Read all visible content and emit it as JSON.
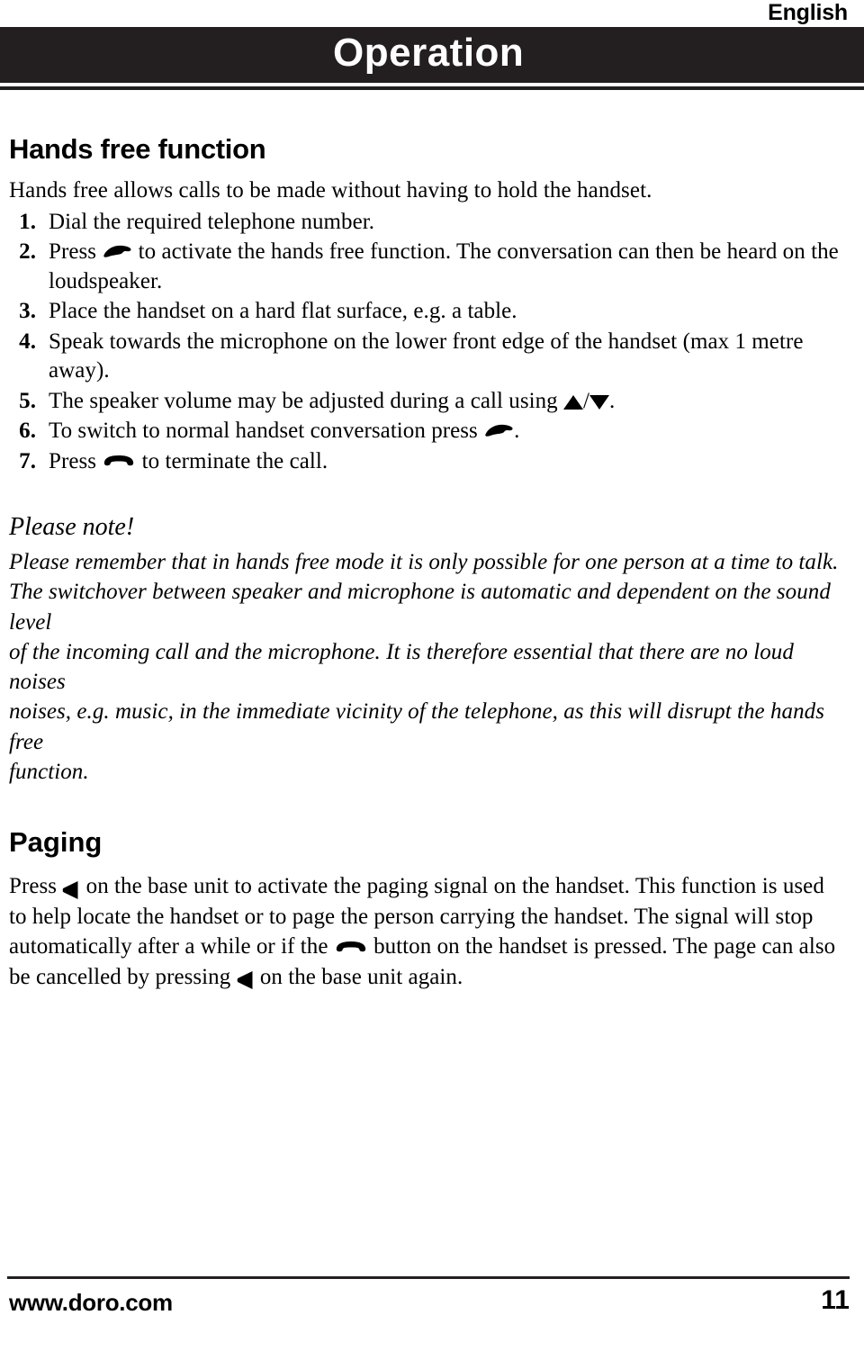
{
  "header": {
    "language": "English",
    "title": "Operation"
  },
  "sections": {
    "hands_free": {
      "heading": "Hands free function",
      "intro": "Hands free allows calls to be made without having to hold the handset.",
      "steps": [
        {
          "num": "1.",
          "parts": [
            {
              "type": "text",
              "value": "Dial the required telephone number."
            }
          ]
        },
        {
          "num": "2.",
          "parts": [
            {
              "type": "text",
              "value": "Press "
            },
            {
              "type": "icon",
              "value": "talk-handset-icon"
            },
            {
              "type": "text",
              "value": " to activate the hands free function. The conversation can then be heard on the loudspeaker."
            }
          ]
        },
        {
          "num": "3.",
          "parts": [
            {
              "type": "text",
              "value": "Place the handset on a hard flat surface, e.g. a table."
            }
          ]
        },
        {
          "num": "4.",
          "parts": [
            {
              "type": "text",
              "value": "Speak towards the microphone on the lower front edge of the handset (max 1 metre away)."
            }
          ]
        },
        {
          "num": "5.",
          "parts": [
            {
              "type": "text",
              "value": "The speaker volume may be adjusted during a call using "
            },
            {
              "type": "icon",
              "value": "volume-up-icon"
            },
            {
              "type": "text",
              "value": "/"
            },
            {
              "type": "icon",
              "value": "volume-down-icon"
            },
            {
              "type": "text",
              "value": "."
            }
          ]
        },
        {
          "num": "6.",
          "parts": [
            {
              "type": "text",
              "value": "To switch to normal handset conversation press "
            },
            {
              "type": "icon",
              "value": "talk-handset-icon"
            },
            {
              "type": "text",
              "value": "."
            }
          ]
        },
        {
          "num": "7.",
          "parts": [
            {
              "type": "text",
              "value": "Press "
            },
            {
              "type": "icon",
              "value": "end-call-handset-icon"
            },
            {
              "type": "text",
              "value": " to terminate the call."
            }
          ]
        }
      ]
    },
    "please_note": {
      "title": "Please note!",
      "lines": [
        "Please remember that in hands free mode it is only possible for one person at a time to talk.",
        "The switchover between speaker and microphone is automatic and dependent on the sound level",
        "of the incoming call and the microphone. It is therefore essential that there are no loud noises",
        "noises, e.g. music, in the immediate vicinity of the telephone, as this will disrupt the hands free",
        "function."
      ]
    },
    "paging": {
      "heading": "Paging",
      "text_1": "Press ",
      "text_2": " on the base unit to activate the paging signal on the handset. This function is used to help locate the handset or to page the person carrying the handset. The signal will stop automatically after a while or if the ",
      "text_3": " button on the handset is pressed. The page can also be cancelled by pressing ",
      "text_4": " on the base unit again."
    }
  },
  "footer": {
    "website": "www.doro.com",
    "page_number": "11"
  }
}
